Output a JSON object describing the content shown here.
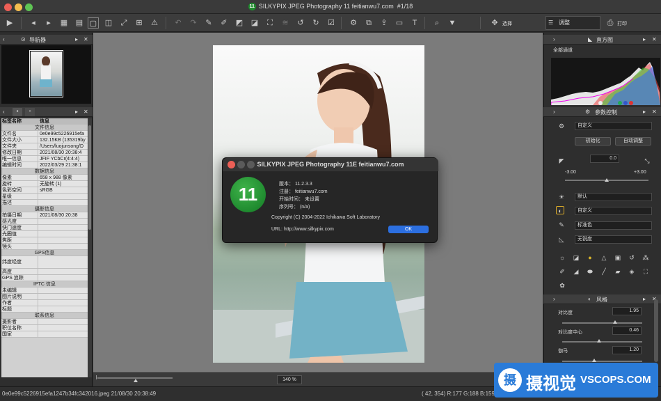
{
  "window": {
    "title": "SILKYPIX JPEG Photography 11 feitianwu7.com",
    "counter": "#1/18",
    "badge": "11"
  },
  "toolbar": {
    "select_label": "选择",
    "adjust_label": "调整",
    "print_label": "打印"
  },
  "navigator": {
    "title": "导航器"
  },
  "info": {
    "col_name": "标签名称",
    "col_info": "信息",
    "sections": {
      "file": "文件信息",
      "data": "数据信息",
      "shoot": "摄影信息",
      "gps": "GPS信息",
      "iptc": "IPTC 信息",
      "contact": "联系信息"
    },
    "rows": {
      "filename": [
        "文件名",
        "0e0e99c5226915efa"
      ],
      "filesize": [
        "文件大小",
        "132.15KB (135319by"
      ],
      "folder": [
        "文件夹",
        "/Users/luojunsong/D"
      ],
      "modified": [
        "修改日期",
        "2021/08/30 20:38:4"
      ],
      "uid": [
        "唯一信息",
        "JFIF YCbCr(4:4:4)"
      ],
      "edited": [
        "编辑时间",
        "2022/03/29 21:38:1"
      ],
      "pixels": [
        "像素",
        "658 x 988 像素"
      ],
      "rotate": [
        "旋转",
        "无旋转 (1)"
      ],
      "colorspace": [
        "色彩空间",
        "sRGB"
      ],
      "stars": [
        "星级",
        ""
      ],
      "desc": [
        "描述",
        ""
      ],
      "shootdate": [
        "拍摄日期",
        "2021/08/30 20:38"
      ],
      "iso": [
        "感光度",
        ""
      ],
      "shutter": [
        "快门速度",
        ""
      ],
      "aperture": [
        "光圈值",
        ""
      ],
      "focal": [
        "焦距",
        ""
      ],
      "lens": [
        "镜头",
        ""
      ],
      "latlon": [
        "纬度经度",
        ""
      ],
      "altitude": [
        "高度",
        ""
      ],
      "gpstrack": [
        "GPS 追踪",
        ""
      ],
      "unedited": [
        "未编辑",
        ""
      ],
      "caption": [
        "图片说明",
        ""
      ],
      "author": [
        "作者",
        ""
      ],
      "title": [
        "标题",
        ""
      ],
      "photographer": [
        "摄影者",
        ""
      ],
      "jobtitle": [
        "职位名称",
        ""
      ],
      "country": [
        "国家",
        ""
      ]
    }
  },
  "zoom": "140 %",
  "status": {
    "file": "0e0e99c5226915efa1247b34fc342016.jpeg 21/08/30 20:38:49",
    "coords": "( 42, 354) R:177 G:188 B:159"
  },
  "dialog": {
    "title": "SILKYPIX JPEG Photography 11E feitianwu7.com",
    "logo": "11",
    "version": "版本： 11.2.3.3",
    "registration": "注册： feitianwu7.com",
    "start": "开始时间： 未设置",
    "serial": "序列号： (n/a)",
    "copyright": "Copyright (C) 2004-2022 Ichikawa Soft Laboratory",
    "url": "URL: http://www.silkypix.com",
    "ok": "OK"
  },
  "histogram": {
    "title": "直方图",
    "channel": "全部通道"
  },
  "params": {
    "title": "参数控制",
    "preset": "自定义",
    "init": "初始化",
    "auto": "自动调整",
    "exposure_value": "0.0",
    "exposure_min": "-3.00",
    "exposure_max": "+3.00",
    "wb": "默认",
    "tone": "自定义",
    "color": "标准色",
    "sharp": "无锐度"
  },
  "style": {
    "title": "风格",
    "contrast_label": "对比度",
    "contrast_value": "1.95",
    "contrast_level": 0.66,
    "contrast_center_label": "对比度中心",
    "contrast_center_value": "0.46",
    "contrast_center_level": 0.46,
    "gamma_label": "伽马",
    "gamma_value": "1.20",
    "gamma_level": 0.4
  },
  "watermark": {
    "cn": "摄视觉",
    "en": "VSCOPS.COM"
  }
}
